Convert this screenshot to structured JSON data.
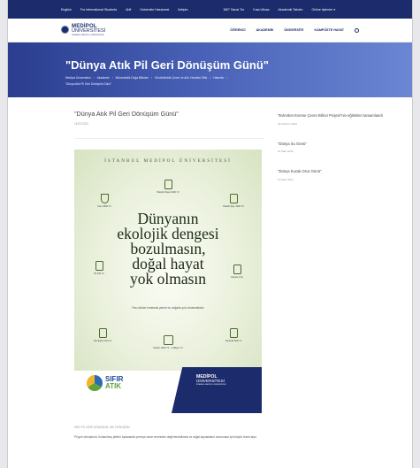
{
  "topbar": {
    "items": [
      "English",
      "For International Students",
      "Ahfl",
      "Üniversite Hastanesi",
      "Iletişim",
      "360° Sanal Tur",
      "Kısa Ulkısa",
      "Akademik Takvim",
      "Online İşlemler ▾"
    ]
  },
  "header": {
    "logo_top": "MEDİPOL",
    "logo_mid": "ÜNİVERSİTESİ",
    "logo_sub": "İSTANBUL MEDİPOL ÜNİVERSİTESİ",
    "nav": [
      "ÖĞRENCİ",
      "AKADEMİK",
      "ÜNİVERSİTE",
      "KAMPÜSTE HAYAT"
    ]
  },
  "hero": {
    "title": "\"Dünya Atık Pil Geri Dönüşüm Günü\"",
    "breadcrumbs": [
      "Medipol Üniversitesi",
      "›",
      "Akademik",
      "›",
      "Mühendislik Doğa Bilimleri",
      "›",
      "Sürdürülebilir Çevre ve Atık Yönetimi Ofisi",
      "›",
      "Haberler",
      "›",
      "\"Dünya Atık Pil Geri Dönüşüm Günü\""
    ]
  },
  "post": {
    "title": "\"Dünya Atık Pil Geri Dönüşüm Günü\"",
    "date": "18.05.2022",
    "caption": "HER PİL GERİ DÖNÜŞÜM, ADI DÖNÜŞÜM",
    "paragraph": "Pil geri dönüşümü, Kullanılmış pillerin toplanarak çevreye zarar vermeden değerlendirilmesi ve doğal kaynakların korunması için büyük önem taşır."
  },
  "poster": {
    "university": "İSTANBUL MEDİPOL ÜNİVERSİTESİ",
    "headline": [
      "Dünyanın",
      "ekolojik dengesi",
      "bozulmasın,",
      "doğal hayat",
      "yok olmasın"
    ],
    "tagline": "Pası atıklar bırakmak yerine bu doğada yok olmamaktadır",
    "items": [
      {
        "label": "Plastik Poşet 1000 Yıl"
      },
      {
        "label": "Cam 4000 Yıl"
      },
      {
        "label": "Plastik Şişe 1000 Yıl"
      },
      {
        "label": "Pil 100 Yıl"
      },
      {
        "label": "Gazete 2 Ay"
      },
      {
        "label": "Süt Şişesi 100 Yıl"
      },
      {
        "label": "Sentetik 500 Yıl"
      },
      {
        "label": "Strafor 1000 Yıl - 1 Milyon Yıl"
      }
    ],
    "zero_a": "SIFIR",
    "zero_b": "ATIK",
    "navy_t1": "MEDİPOL",
    "navy_t2": "ÜNİVERSİTESİ",
    "navy_t3": "İSTANBUL MEDİPOL ÜNİVERSİTESİ"
  },
  "sidebar": {
    "items": [
      {
        "title": "\"Evlerden Evrene Çevre Bilinci Projesi\"nin eğitimleri tamamlandı",
        "date": "30 Haziran 2022"
      },
      {
        "title": "\"Dünya Su Günü\"",
        "date": "22 Mart 2022"
      },
      {
        "title": "\"Dünya Kuzak Oruz Günü\"",
        "date": "10 Mart 2022"
      }
    ]
  }
}
